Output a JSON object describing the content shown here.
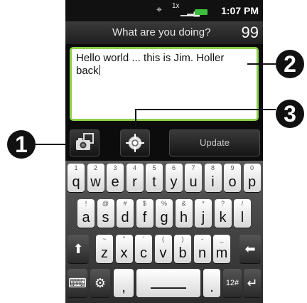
{
  "status_bar": {
    "gps_icon": "crosshair-icon",
    "network_label": "1x",
    "signal_icon": "signal-icon",
    "battery_icon": "battery-icon",
    "time": "1:07 PM"
  },
  "compose": {
    "prompt": "What are you doing?",
    "char_count": "99",
    "text_line1": "Hello world ... this is Jim. Holler",
    "text_line2": "back"
  },
  "toolbar": {
    "camera_icon": "camera-icon",
    "location_icon": "location-icon",
    "update_label": "Update"
  },
  "keyboard": {
    "row1": [
      {
        "hint": "1",
        "main": "q"
      },
      {
        "hint": "2",
        "main": "w"
      },
      {
        "hint": "3",
        "main": "e"
      },
      {
        "hint": "4",
        "main": "r"
      },
      {
        "hint": "5",
        "main": "t"
      },
      {
        "hint": "6",
        "main": "y"
      },
      {
        "hint": "7",
        "main": "u"
      },
      {
        "hint": "8",
        "main": "i"
      },
      {
        "hint": "9",
        "main": "o"
      },
      {
        "hint": "0",
        "main": "p"
      }
    ],
    "row2": [
      {
        "hint": "!",
        "main": "a"
      },
      {
        "hint": "@",
        "main": "s"
      },
      {
        "hint": "#",
        "main": "d"
      },
      {
        "hint": "$",
        "main": "f"
      },
      {
        "hint": "%",
        "main": "g"
      },
      {
        "hint": "&",
        "main": "h"
      },
      {
        "hint": "*",
        "main": "j"
      },
      {
        "hint": "?",
        "main": "k"
      },
      {
        "hint": "/",
        "main": "l"
      }
    ],
    "row3": [
      {
        "hint": "~",
        "main": "z"
      },
      {
        "hint": "\"",
        "main": "x"
      },
      {
        "hint": "'",
        "main": "c"
      },
      {
        "hint": "(",
        "main": "v"
      },
      {
        "hint": ")",
        "main": "b"
      },
      {
        "hint": "-",
        "main": "n"
      },
      {
        "hint": "_",
        "main": "m"
      }
    ],
    "shift_glyph": "⬆",
    "backspace_glyph": "⬅",
    "keyboard_glyph": "⌨",
    "settings_glyph": "⚙",
    "comma": ",",
    "period": ".",
    "symbols_label": "12#",
    "enter_glyph": "↵"
  },
  "callouts": {
    "one": "1",
    "two": "2",
    "three": "3"
  }
}
